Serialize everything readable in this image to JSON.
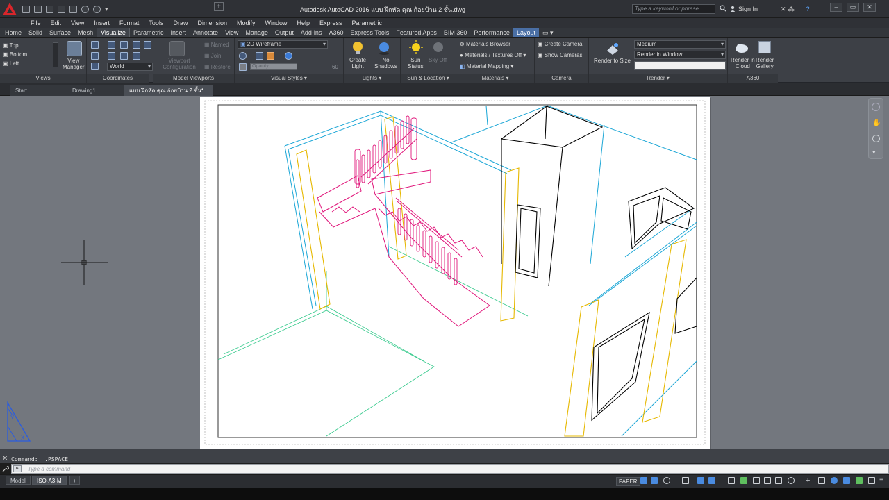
{
  "app": {
    "title": "Autodesk AutoCAD 2016   แบบ ฝึกหัด  คุณ ก้อยบ้าน 2 ชั้น.dwg",
    "search_placeholder": "Type a keyword or phrase",
    "sign_in": "Sign In",
    "logo_color": "#d9262b"
  },
  "menu": [
    "File",
    "Edit",
    "View",
    "Insert",
    "Format",
    "Tools",
    "Draw",
    "Dimension",
    "Modify",
    "Window",
    "Help",
    "Express",
    "Parametric"
  ],
  "ribbon_tabs": [
    "Home",
    "Solid",
    "Surface",
    "Mesh",
    "Visualize",
    "Parametric",
    "Insert",
    "Annotate",
    "View",
    "Manage",
    "Output",
    "Add-ins",
    "A360",
    "Express Tools",
    "Featured Apps",
    "BIM 360",
    "Performance",
    "Layout"
  ],
  "ribbon_active_tab": "Visualize",
  "ribbon": {
    "views": {
      "items": [
        "Top",
        "Bottom",
        "Left"
      ],
      "view_manager": "View\nManager",
      "title": "Views"
    },
    "coordinates": {
      "ucs": "World",
      "title": "Coordinates"
    },
    "model_viewports": {
      "config": "Viewport\nConfiguration",
      "named": "Named",
      "join": "Join",
      "restore": "Restore",
      "title": "Model Viewports"
    },
    "visual_styles": {
      "style": "2D Wireframe",
      "opacity_label": "Opacity",
      "opacity_value": "60",
      "title": "Visual Styles"
    },
    "lights": {
      "create_light": "Create\nLight",
      "no_shadows": "No\nShadows",
      "title": "Lights"
    },
    "sun": {
      "sun_status": "Sun\nStatus",
      "sky_off": "Sky Off",
      "title": "Sun & Location"
    },
    "materials": {
      "browser": "Materials Browser",
      "textures": "Materials / Textures Off",
      "mapping": "Material Mapping",
      "title": "Materials"
    },
    "camera": {
      "create": "Create Camera",
      "show": "Show  Cameras",
      "title": "Camera"
    },
    "render": {
      "render_to_size": "Render to Size",
      "quality": "Medium",
      "render_in": "Render in Window",
      "title": "Render"
    },
    "a360": {
      "render_cloud": "Render in\nCloud",
      "render_gallery": "Render\nGallery",
      "title": "A360"
    }
  },
  "file_tabs": [
    "Start",
    "Drawing1",
    "แบบ ฝึกหัด  คุณ ก้อยบ้าน 2 ชั้น*"
  ],
  "file_tab_active": 2,
  "command": {
    "history": "Command:  _.PSPACE",
    "placeholder": "Type  a  command"
  },
  "layout_tabs": [
    "Model",
    "ISO-A3-M"
  ],
  "layout_tab_active": 1,
  "status": {
    "space": "PAPER"
  },
  "drawing_colors": {
    "stair": "#e0157a",
    "wall_cyan": "#1aa6d6",
    "column_yellow": "#e6b800",
    "floor_green": "#34c98b",
    "outline": "#000000"
  }
}
